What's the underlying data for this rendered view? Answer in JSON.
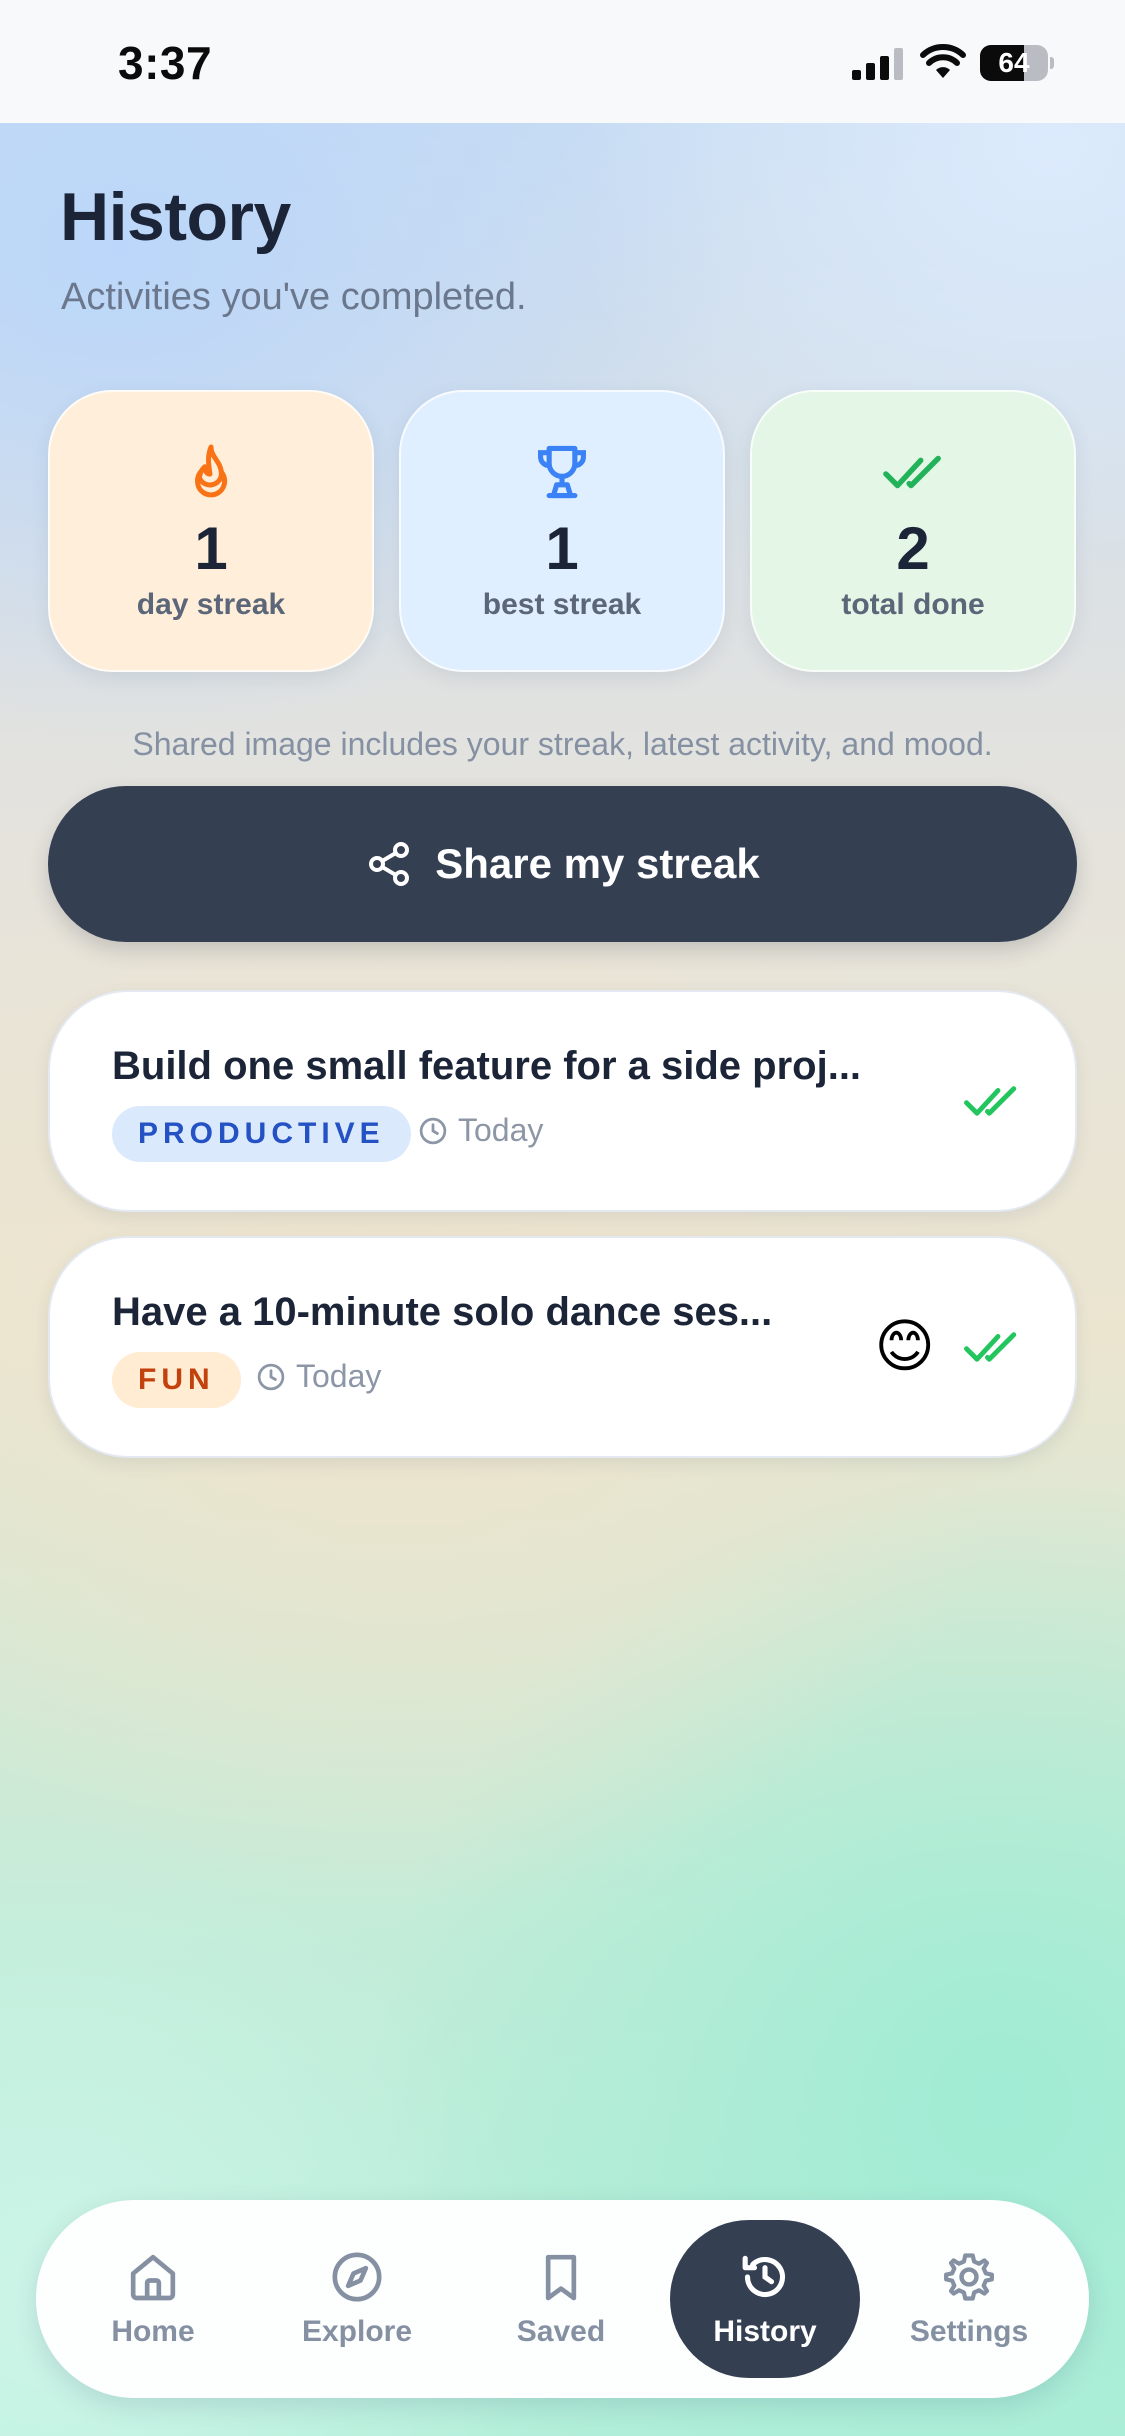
{
  "status_bar": {
    "time": "3:37",
    "battery": "64",
    "battery_level": 0.64
  },
  "header": {
    "title": "History",
    "subtitle": "Activities you've completed."
  },
  "stats": [
    {
      "value": "1",
      "label": "day streak",
      "icon": "flame-icon",
      "bg": "#ffefda",
      "color": "#f97316"
    },
    {
      "value": "1",
      "label": "best streak",
      "icon": "trophy-icon",
      "bg": "#e0efff",
      "color": "#3b82f6"
    },
    {
      "value": "2",
      "label": "total done",
      "icon": "double-check-icon",
      "bg": "#e4f6e6",
      "color": "#22b35a"
    }
  ],
  "share": {
    "note": "Shared image includes your streak, latest activity, and mood.",
    "button_label": "Share my streak"
  },
  "activities": [
    {
      "title": "Build one small feature for a side proj...",
      "tag": "PRODUCTIVE",
      "time": "Today",
      "mood": ""
    },
    {
      "title": "Have a 10-minute solo dance ses...",
      "tag": "FUN",
      "time": "Today",
      "mood": "😊"
    }
  ],
  "nav": {
    "items": [
      {
        "label": "Home",
        "icon": "home-icon"
      },
      {
        "label": "Explore",
        "icon": "compass-icon"
      },
      {
        "label": "Saved",
        "icon": "bookmark-icon"
      },
      {
        "label": "History",
        "icon": "history-icon",
        "active": true
      },
      {
        "label": "Settings",
        "icon": "gear-icon"
      }
    ]
  },
  "colors": {
    "accent_dark": "#343f52",
    "check_green": "#22c55e",
    "productive": "#2452c4",
    "fun": "#c2410c"
  }
}
